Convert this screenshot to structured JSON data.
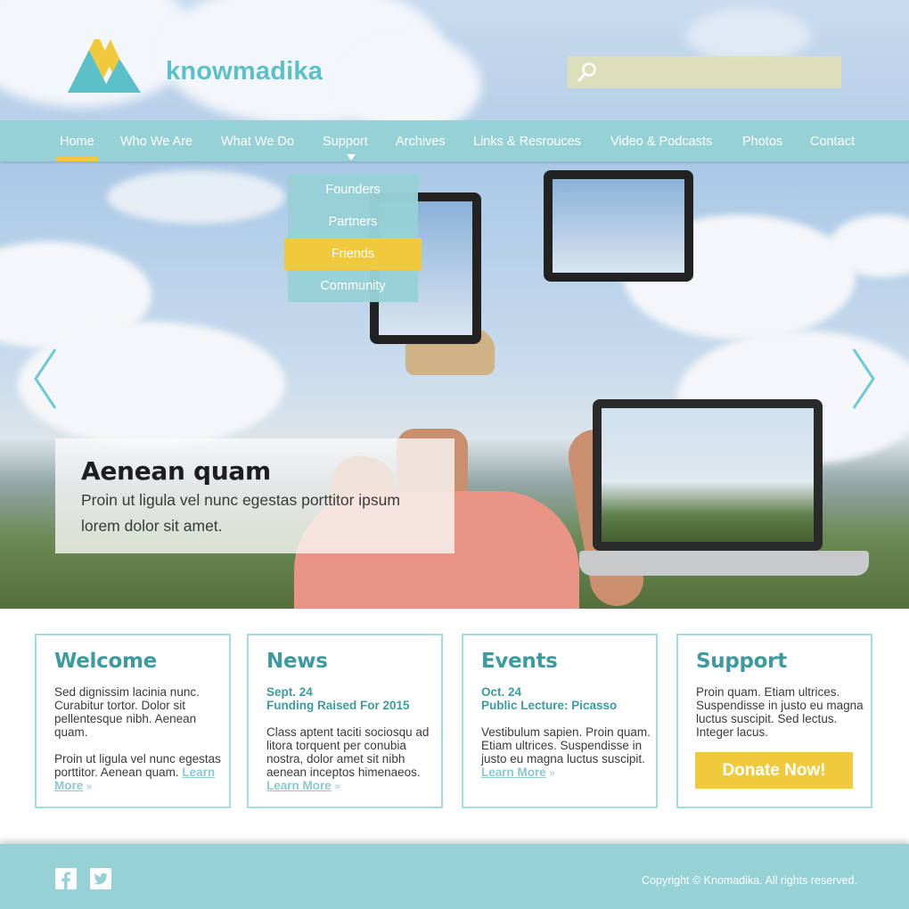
{
  "brand": {
    "name": "knowmadika",
    "logo_colors": {
      "primary": "#5bc0c8",
      "accent": "#f0c93c"
    }
  },
  "search": {
    "placeholder": "",
    "icon": "search-icon"
  },
  "nav": {
    "items": [
      {
        "label": "Home",
        "active": true
      },
      {
        "label": "Who We Are"
      },
      {
        "label": "What We Do"
      },
      {
        "label": "Support"
      },
      {
        "label": "Archives"
      },
      {
        "label": "Links & Resrouces"
      },
      {
        "label": "Video & Podcasts"
      },
      {
        "label": "Photos"
      },
      {
        "label": "Contact"
      }
    ],
    "dropdown": {
      "parent": "Support",
      "items": [
        {
          "label": "Founders"
        },
        {
          "label": "Partners"
        },
        {
          "label": "Friends",
          "highlighted": true
        },
        {
          "label": "Community"
        }
      ]
    }
  },
  "hero": {
    "caption_title": "Aenean quam",
    "caption_text": "Proin ut ligula vel nunc egestas porttitor ipsum lorem dolor sit amet.",
    "prev_icon": "chevron-left-icon",
    "next_icon": "chevron-right-icon"
  },
  "cards": {
    "welcome": {
      "title": "Welcome",
      "para1": "Sed dignissim lacinia nunc. Curabitur tortor. Dolor sit pellentesque nibh. Aenean quam.",
      "para2": "Proin ut ligula vel nunc egestas porttitor.  Aenean quam.",
      "link": "Learn More",
      "link_arrow": "»"
    },
    "news": {
      "title": "News",
      "date": "Sept. 24",
      "headline": "Funding Raised For 2015",
      "text": "Class aptent taciti sociosqu ad litora torquent per conubia nostra, dolor amet sit nibh aenean inceptos himenaeos.",
      "link": "Learn More",
      "link_arrow": "»"
    },
    "events": {
      "title": "Events",
      "date": "Oct. 24",
      "headline": "Public Lecture: Picasso",
      "text": "Vestibulum sapien. Proin quam. Etiam ultrices. Suspendisse in justo eu magna luctus suscipit.",
      "link": "Learn More",
      "link_arrow": "»"
    },
    "support": {
      "title": "Support",
      "text": "Proin quam. Etiam ultrices. Suspendisse in justo eu magna luctus suscipit. Sed lectus. Integer lacus.",
      "button": "Donate Now!"
    }
  },
  "footer": {
    "social": [
      {
        "icon": "facebook-icon",
        "glyph": "f"
      },
      {
        "icon": "twitter-icon",
        "glyph": "t"
      }
    ],
    "copyright": "Copyright © Knomadika. All rights reserved."
  },
  "colors": {
    "teal": "#96d1d6",
    "teal_dark": "#3c9aa1",
    "yellow": "#f0c93c",
    "card_border": "#a3dce1"
  }
}
